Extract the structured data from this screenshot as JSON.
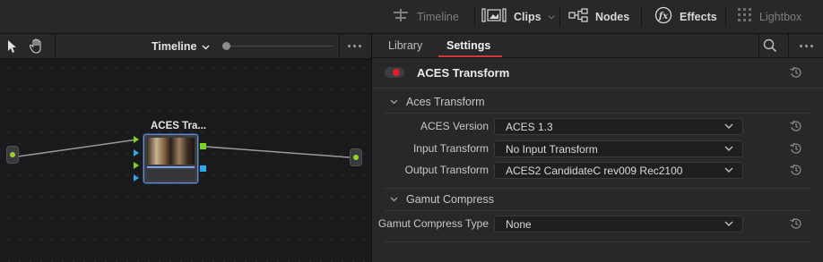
{
  "topbar": {
    "timeline": "Timeline",
    "clips": "Clips",
    "nodes": "Nodes",
    "effects": "Effects",
    "lightbox": "Lightbox"
  },
  "node_editor": {
    "title": "Timeline",
    "node_label": "ACES Tra..."
  },
  "settings": {
    "tabs": [
      {
        "label": "Library"
      },
      {
        "label": "Settings"
      }
    ],
    "active_tab": "Settings",
    "effect_name": "ACES Transform",
    "sections": [
      {
        "title": "Aces Transform",
        "rows": [
          {
            "label": "ACES Version",
            "value": "ACES 1.3"
          },
          {
            "label": "Input Transform",
            "value": "No Input Transform"
          },
          {
            "label": "Output Transform",
            "value": "ACES2 CandidateC rev009 Rec2100"
          }
        ]
      },
      {
        "title": "Gamut Compress",
        "rows": [
          {
            "label": "Gamut Compress Type",
            "value": "None"
          }
        ]
      }
    ]
  },
  "colors": {
    "accent_red": "#d23a3a",
    "port_green": "#7ed321",
    "port_blue": "#2ea8e8"
  }
}
